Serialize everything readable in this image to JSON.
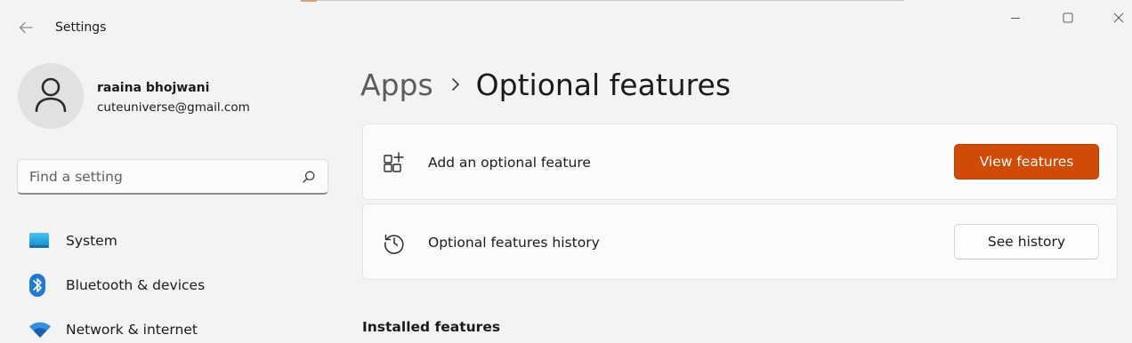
{
  "window": {
    "title": "Settings",
    "controls": [
      "minimize",
      "maximize",
      "close"
    ]
  },
  "profile": {
    "name": "raaina bhojwani",
    "email": "cuteuniverse@gmail.com"
  },
  "search": {
    "placeholder": "Find a setting",
    "value": ""
  },
  "sidebar": {
    "items": [
      {
        "label": "System",
        "icon": "system-icon"
      },
      {
        "label": "Bluetooth & devices",
        "icon": "bluetooth-icon"
      },
      {
        "label": "Network & internet",
        "icon": "wifi-icon"
      }
    ]
  },
  "breadcrumb": {
    "parent": "Apps",
    "current": "Optional features"
  },
  "cards": {
    "add": {
      "label": "Add an optional feature",
      "button": "View features",
      "icon": "add-feature-icon"
    },
    "history": {
      "label": "Optional features history",
      "button": "See history",
      "icon": "history-icon"
    }
  },
  "sections": {
    "installed_title": "Installed features"
  },
  "colors": {
    "accent": "#d14a06",
    "background": "#f3f3f3",
    "card": "#fbfbfb"
  }
}
